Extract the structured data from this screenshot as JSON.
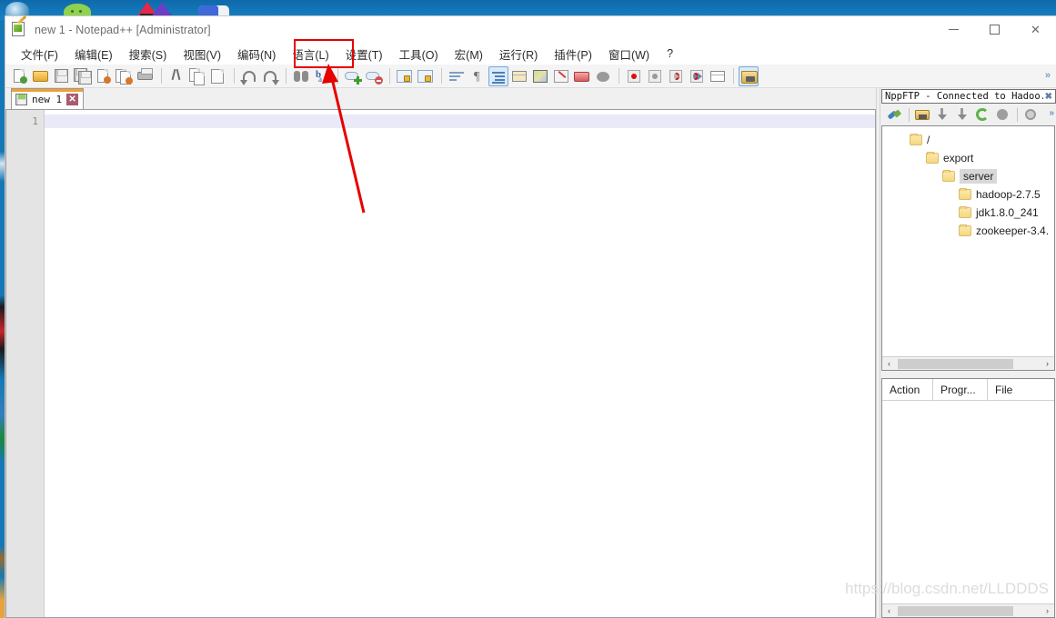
{
  "desktop": {
    "icons": [
      "browser-globe-icon",
      "wechat-icon",
      "media-app-icon",
      "app-icon"
    ]
  },
  "window": {
    "title": "new 1 - Notepad++ [Administrator]",
    "app_icon": "notepad-plus-plus-icon",
    "controls": {
      "minimize": "–",
      "maximize": "□",
      "close": "✕"
    }
  },
  "menubar": {
    "items": [
      {
        "label": "文件(F)",
        "name": "menu-file"
      },
      {
        "label": "编辑(E)",
        "name": "menu-edit"
      },
      {
        "label": "搜索(S)",
        "name": "menu-search"
      },
      {
        "label": "视图(V)",
        "name": "menu-view"
      },
      {
        "label": "编码(N)",
        "name": "menu-encoding"
      },
      {
        "label": "语言(L)",
        "name": "menu-language"
      },
      {
        "label": "设置(T)",
        "name": "menu-settings"
      },
      {
        "label": "工具(O)",
        "name": "menu-tools"
      },
      {
        "label": "宏(M)",
        "name": "menu-macro"
      },
      {
        "label": "运行(R)",
        "name": "menu-run"
      },
      {
        "label": "插件(P)",
        "name": "menu-plugins"
      },
      {
        "label": "窗口(W)",
        "name": "menu-window"
      },
      {
        "label": "?",
        "name": "menu-help"
      }
    ]
  },
  "annotation": {
    "highlight_color": "#e60000",
    "highlight_target": "设置(T)",
    "arrow_color": "#e60000"
  },
  "toolbar": {
    "overflow": "»",
    "buttons": [
      "new-file-icon",
      "open-file-icon",
      "save-icon",
      "save-all-icon",
      "close-file-icon",
      "close-all-icon",
      "print-icon",
      "cut-icon",
      "copy-icon",
      "paste-icon",
      "undo-icon",
      "redo-icon",
      "find-icon",
      "replace-icon",
      "zoom-in-icon",
      "zoom-out-icon",
      "sync-vertical-icon",
      "sync-horizontal-icon",
      "word-wrap-icon",
      "show-all-chars-icon",
      "indent-guide-icon",
      "user-define-dialog-icon",
      "document-map-icon",
      "function-list-icon",
      "folder-as-workspace-icon",
      "monitoring-icon",
      "record-macro-icon",
      "stop-macro-icon",
      "play-macro-icon",
      "run-macro-multiple-icon",
      "save-macro-icon",
      "ftp-icon"
    ]
  },
  "editor": {
    "tab": {
      "label": "new 1",
      "icon": "saved-file-icon",
      "close": "✕"
    },
    "line_numbers": [
      "1"
    ],
    "content": ""
  },
  "ftp_panel": {
    "caption": "NppFTP - Connected to Hadoo...",
    "close": "✖",
    "toolbar": {
      "more": "»",
      "buttons": [
        "connect-icon",
        "open-directory-icon",
        "download-icon",
        "upload-icon",
        "refresh-icon",
        "abort-icon",
        "settings-gear-icon"
      ]
    },
    "tree": [
      {
        "label": "/",
        "indent": 0,
        "selected": false
      },
      {
        "label": "export",
        "indent": 1,
        "selected": false
      },
      {
        "label": "server",
        "indent": 2,
        "selected": true
      },
      {
        "label": "hadoop-2.7.5",
        "indent": 3,
        "selected": false
      },
      {
        "label": "jdk1.8.0_241",
        "indent": 3,
        "selected": false
      },
      {
        "label": "zookeeper-3.4.",
        "indent": 3,
        "selected": false
      }
    ],
    "scroll": {
      "left": "‹",
      "right": "›"
    },
    "queue": {
      "columns": [
        "Action",
        "Progr...",
        "File"
      ],
      "rows": []
    }
  },
  "watermark": "https://blog.csdn.net/LLDDDS"
}
